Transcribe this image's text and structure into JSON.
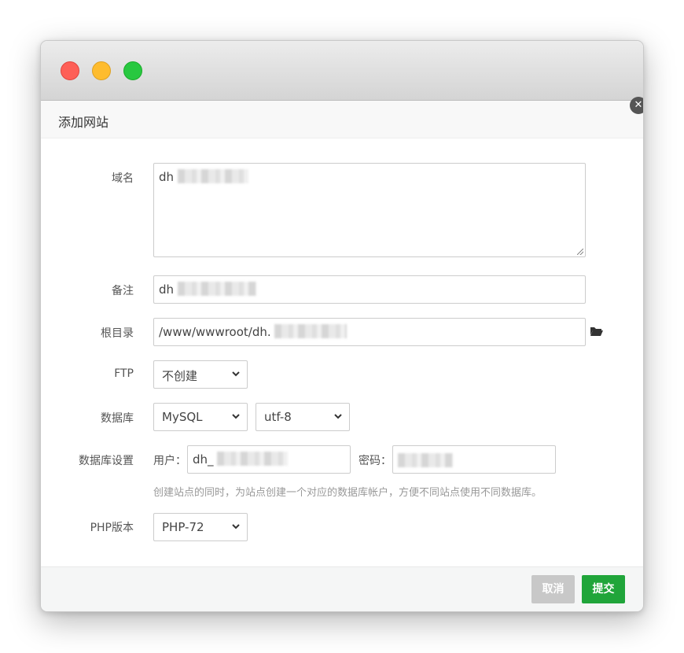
{
  "dialog": {
    "title": "添加网站"
  },
  "form": {
    "domain": {
      "label": "域名",
      "value": "dh"
    },
    "remark": {
      "label": "备注",
      "value": "dh"
    },
    "root": {
      "label": "根目录",
      "value": "/www/wwwroot/dh."
    },
    "ftp": {
      "label": "FTP",
      "selected": "不创建"
    },
    "database": {
      "label": "数据库",
      "type_selected": "MySQL",
      "charset_selected": "utf-8"
    },
    "db_settings": {
      "label": "数据库设置",
      "user_label": "用户：",
      "user_value": "dh_",
      "password_label": "密码：",
      "hint": "创建站点的同时，为站点创建一个对应的数据库帐户，方便不同站点使用不同数据库。"
    },
    "php": {
      "label": "PHP版本",
      "selected": "PHP-72"
    }
  },
  "footer": {
    "cancel_label": "取消",
    "submit_label": "提交"
  },
  "icons": {
    "close": "close-icon",
    "folder": "folder-open-icon",
    "chevron": "chevron-down-icon"
  },
  "colors": {
    "submit": "#20a53a",
    "cancel": "#c8c8c8",
    "traffic_red": "#fe5f57",
    "traffic_yellow": "#febc2e",
    "traffic_green": "#28c840"
  }
}
